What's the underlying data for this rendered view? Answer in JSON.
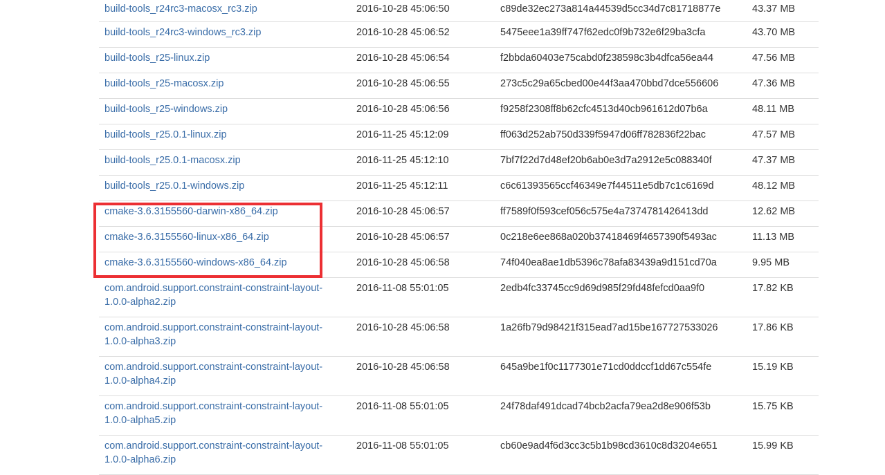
{
  "files": [
    {
      "name": "build-tools_r24rc3-macosx_rc3.zip",
      "date": "2016-10-28 45:06:50",
      "sha1": "c89de32ec273a814a44539d5cc34d7c81718877e",
      "size": "43.37 MB"
    },
    {
      "name": "build-tools_r24rc3-windows_rc3.zip",
      "date": "2016-10-28 45:06:52",
      "sha1": "5475eee1a39ff747f62edc0f9b732e6f29ba3cfa",
      "size": "43.70 MB"
    },
    {
      "name": "build-tools_r25-linux.zip",
      "date": "2016-10-28 45:06:54",
      "sha1": "f2bbda60403e75cabd0f238598c3b4dfca56ea44",
      "size": "47.56 MB"
    },
    {
      "name": "build-tools_r25-macosx.zip",
      "date": "2016-10-28 45:06:55",
      "sha1": "273c5c29a65cbed00e44f3aa470bbd7dce556606",
      "size": "47.36 MB"
    },
    {
      "name": "build-tools_r25-windows.zip",
      "date": "2016-10-28 45:06:56",
      "sha1": "f9258f2308ff8b62cfc4513d40cb961612d07b6a",
      "size": "48.11 MB"
    },
    {
      "name": "build-tools_r25.0.1-linux.zip",
      "date": "2016-11-25 45:12:09",
      "sha1": "ff063d252ab750d339f5947d06ff782836f22bac",
      "size": "47.57 MB"
    },
    {
      "name": "build-tools_r25.0.1-macosx.zip",
      "date": "2016-11-25 45:12:10",
      "sha1": "7bf7f22d7d48ef20b6ab0e3d7a2912e5c088340f",
      "size": "47.37 MB"
    },
    {
      "name": "build-tools_r25.0.1-windows.zip",
      "date": "2016-11-25 45:12:11",
      "sha1": "c6c61393565ccf46349e7f44511e5db7c1c6169d",
      "size": "48.12 MB"
    },
    {
      "name": "cmake-3.6.3155560-darwin-x86_64.zip",
      "date": "2016-10-28 45:06:57",
      "sha1": "ff7589f0f593cef056c575e4a7374781426413dd",
      "size": "12.62 MB"
    },
    {
      "name": "cmake-3.6.3155560-linux-x86_64.zip",
      "date": "2016-10-28 45:06:57",
      "sha1": "0c218e6ee868a020b37418469f4657390f5493ac",
      "size": "11.13 MB"
    },
    {
      "name": "cmake-3.6.3155560-windows-x86_64.zip",
      "date": "2016-10-28 45:06:58",
      "sha1": "74f040ea8ae1db5396c78afa83439a9d151cd70a",
      "size": "9.95 MB"
    },
    {
      "name": "com.android.support.constraint-constraint-layout-1.0.0-alpha2.zip",
      "date": "2016-11-08 55:01:05",
      "sha1": "2edb4fc33745cc9d69d985f29fd48fefcd0aa9f0",
      "size": "17.82 KB"
    },
    {
      "name": "com.android.support.constraint-constraint-layout-1.0.0-alpha3.zip",
      "date": "2016-10-28 45:06:58",
      "sha1": "1a26fb79d98421f315ead7ad15be167727533026",
      "size": "17.86 KB"
    },
    {
      "name": "com.android.support.constraint-constraint-layout-1.0.0-alpha4.zip",
      "date": "2016-10-28 45:06:58",
      "sha1": "645a9be1f0c1177301e71cd0ddccf1dd67c554fe",
      "size": "15.19 KB"
    },
    {
      "name": "com.android.support.constraint-constraint-layout-1.0.0-alpha5.zip",
      "date": "2016-11-08 55:01:05",
      "sha1": "24f78daf491dcad74bcb2acfa79ea2d8e906f53b",
      "size": "15.75 KB"
    },
    {
      "name": "com.android.support.constraint-constraint-layout-1.0.0-alpha6.zip",
      "date": "2016-11-08 55:01:05",
      "sha1": "cb60e9ad4f6d3cc3c5b1b98cd3610c8d3204e651",
      "size": "15.99 KB"
    }
  ],
  "colors": {
    "link": "#3a6da8",
    "text": "#333333",
    "divider": "#dddddd",
    "highlight": "#ec2f33"
  }
}
